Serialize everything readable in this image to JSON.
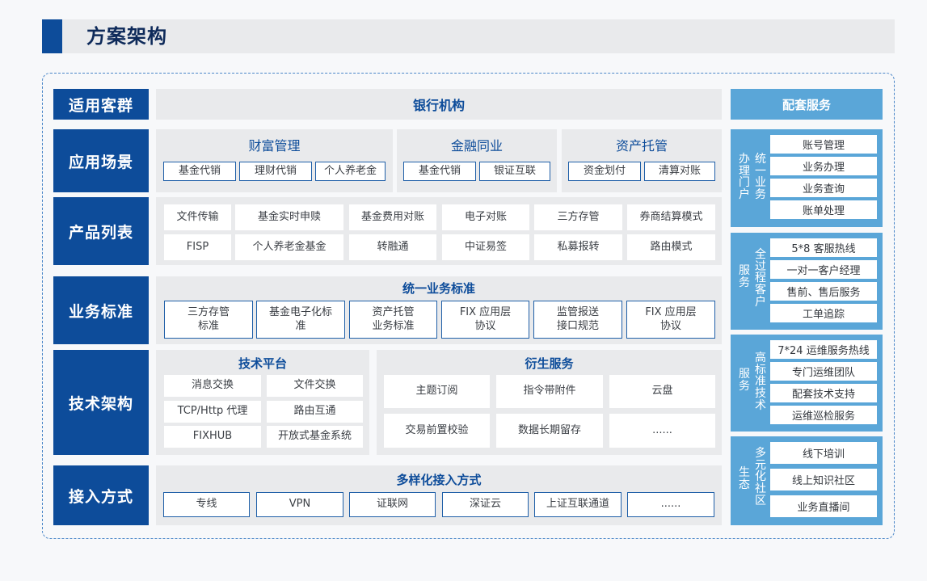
{
  "title": "方案架构",
  "headers": {
    "customers": "适用客群",
    "scenarios": "应用场景",
    "products": "产品列表",
    "standards": "业务标准",
    "tech": "技术架构",
    "access": "接入方式"
  },
  "customers": {
    "bank": "银行机构"
  },
  "scenarios": {
    "wealth": {
      "title": "财富管理",
      "items": [
        "基金代销",
        "理财代销",
        "个人养老金"
      ]
    },
    "interbank": {
      "title": "金融同业",
      "items": [
        "基金代销",
        "银证互联"
      ]
    },
    "custody": {
      "title": "资产托管",
      "items": [
        "资金划付",
        "清算对账"
      ]
    }
  },
  "products": {
    "row1": [
      "文件传输",
      "基金实时申赎",
      "基金费用对账",
      "电子对账",
      "三方存管",
      "券商结算模式"
    ],
    "row2": [
      "FISP",
      "个人养老金基金",
      "转融通",
      "中证易签",
      "私募报转",
      "路由模式"
    ]
  },
  "standards": {
    "title": "统一业务标准",
    "items": [
      [
        "三方存管",
        "标准"
      ],
      [
        "基金电子化标",
        "准"
      ],
      [
        "资产托管",
        "业务标准"
      ],
      [
        "FIX 应用层",
        "协议"
      ],
      [
        "监管报送",
        "接口规范"
      ],
      [
        "FIX 应用层",
        "协议"
      ]
    ]
  },
  "tech": {
    "platform": {
      "title": "技术平台",
      "items": [
        "消息交换",
        "文件交换",
        "TCP/Http 代理",
        "路由互通",
        "FIXHUB",
        "开放式基金系统"
      ]
    },
    "derived": {
      "title": "衍生服务",
      "items": [
        "主题订阅",
        "指令带附件",
        "云盘",
        "交易前置校验",
        "数据长期留存",
        "......"
      ]
    }
  },
  "access": {
    "title": "多样化接入方式",
    "items": [
      "专线",
      "VPN",
      "证联网",
      "深证云",
      "上证互联通道",
      "......"
    ]
  },
  "services": {
    "title": "配套服务",
    "groups": [
      {
        "label_a": "办理门户",
        "label_b": "统一业务",
        "items": [
          "账号管理",
          "业务办理",
          "业务查询",
          "账单处理"
        ]
      },
      {
        "label_a": "服务",
        "label_b": "全过程客户",
        "items": [
          "5*8 客服热线",
          "一对一客户经理",
          "售前、售后服务",
          "工单追踪"
        ]
      },
      {
        "label_a": "服务",
        "label_b": "高标准技术",
        "items": [
          "7*24 运维服务热线",
          "专门运维团队",
          "配套技术支持",
          "运维巡检服务"
        ]
      },
      {
        "label_a": "生态",
        "label_b": "多元化社区",
        "items": [
          "线下培训",
          "线上知识社区",
          "业务直播间"
        ]
      }
    ]
  },
  "colors": {
    "navy": "#0d4c9a",
    "panel": "#e9eaec",
    "light_blue": "#5aa6d8",
    "outline_blue": "#1f5fa8"
  }
}
